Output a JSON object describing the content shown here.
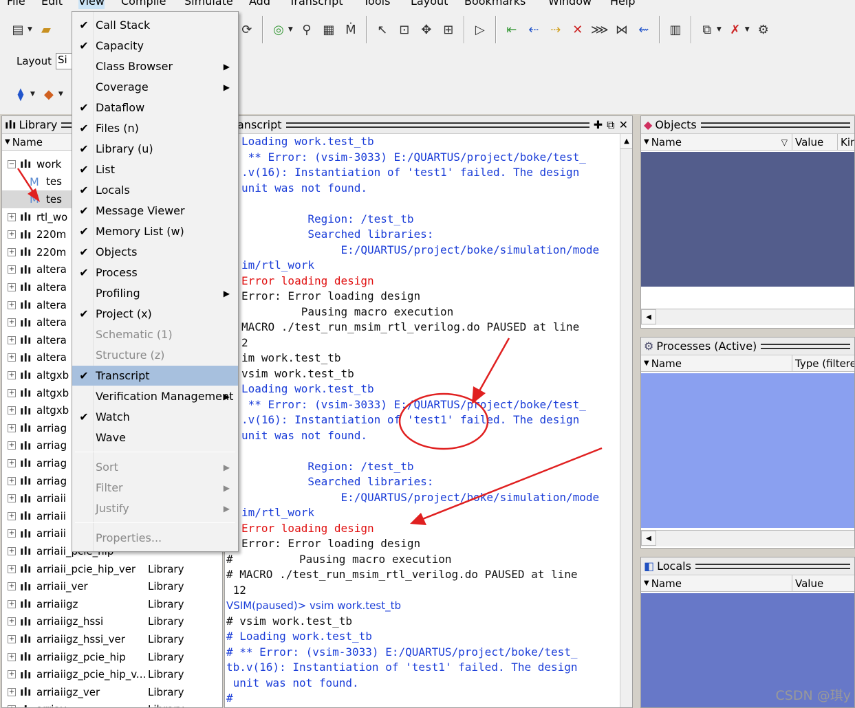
{
  "menubar": {
    "items": [
      "File",
      "Edit",
      "View",
      "Compile",
      "Simulate",
      "Add",
      "Transcript",
      "Tools",
      "Layout",
      "Bookmarks",
      "Window",
      "Help"
    ]
  },
  "toolbar": {
    "layout_label": "Layout",
    "layout_value": "Si"
  },
  "library": {
    "title": "Library",
    "col_name": "Name",
    "work": "work",
    "work_child1": "tes",
    "work_child2": "tes",
    "rows_truncated": [
      "rtl_wo",
      "220m",
      "220m",
      "altera",
      "altera",
      "altera",
      "altera",
      "altera",
      "altera",
      "altgxb",
      "altgxb",
      "altgxb",
      "arriag",
      "arriag",
      "arriag",
      "arriag",
      "arriaii",
      "arriaii",
      "arriaii",
      "arriaii_pcie_hip"
    ],
    "rows_full": [
      {
        "name": "arriaii_pcie_hip_ver",
        "type": "Library"
      },
      {
        "name": "arriaii_ver",
        "type": "Library"
      },
      {
        "name": "arriaiigz",
        "type": "Library"
      },
      {
        "name": "arriaiigz_hssi",
        "type": "Library"
      },
      {
        "name": "arriaiigz_hssi_ver",
        "type": "Library"
      },
      {
        "name": "arriaiigz_pcie_hip",
        "type": "Library"
      },
      {
        "name": "arriaiigz_pcie_hip_v...",
        "type": "Library"
      },
      {
        "name": "arriaiigz_ver",
        "type": "Library"
      },
      {
        "name": "arriav",
        "type": "Library"
      }
    ],
    "partial_type": "Library"
  },
  "view_menu": {
    "items": [
      {
        "label": "Call Stack",
        "checked": true
      },
      {
        "label": "Capacity",
        "checked": true
      },
      {
        "label": "Class Browser",
        "checked": false,
        "submenu": true
      },
      {
        "label": "Coverage",
        "checked": false,
        "submenu": true
      },
      {
        "label": "Dataflow",
        "checked": true
      },
      {
        "label": "Files (n)",
        "checked": true
      },
      {
        "label": "Library (u)",
        "checked": true
      },
      {
        "label": "List",
        "checked": true
      },
      {
        "label": "Locals",
        "checked": true
      },
      {
        "label": "Message Viewer",
        "checked": true
      },
      {
        "label": "Memory List (w)",
        "checked": true
      },
      {
        "label": "Objects",
        "checked": true
      },
      {
        "label": "Process",
        "checked": true
      },
      {
        "label": "Profiling",
        "checked": false,
        "submenu": true
      },
      {
        "label": "Project (x)",
        "checked": true
      },
      {
        "label": "Schematic (1)",
        "checked": false,
        "disabled": true
      },
      {
        "label": "Structure (z)",
        "checked": false,
        "disabled": true
      },
      {
        "label": "Transcript",
        "checked": true,
        "active": true
      },
      {
        "label": "Verification Management",
        "checked": false,
        "submenu": true
      },
      {
        "label": "Watch",
        "checked": true
      },
      {
        "label": "Wave",
        "checked": false
      }
    ],
    "group2": [
      {
        "label": "Sort",
        "submenu": true,
        "disabled": true
      },
      {
        "label": "Filter",
        "submenu": true,
        "disabled": true
      },
      {
        "label": "Justify",
        "submenu": true,
        "disabled": true
      }
    ],
    "group3": [
      {
        "label": "Properties...",
        "disabled": true
      }
    ]
  },
  "transcript": {
    "title": "Transcript",
    "lines": [
      {
        "text": "Loading work.test_tb",
        "color": "blue"
      },
      {
        "text": " ** Error: (vsim-3033) E:/QUARTUS/project/boke/test_",
        "color": "blue"
      },
      {
        "text": ".v(16): Instantiation of 'test1' failed. The design",
        "color": "blue"
      },
      {
        "text": "unit was not found.",
        "color": "blue"
      },
      {
        "text": "",
        "color": "blue"
      },
      {
        "text": "          Region: /test_tb",
        "color": "blue"
      },
      {
        "text": "          Searched libraries:",
        "color": "blue"
      },
      {
        "text": "               E:/QUARTUS/project/boke/simulation/mode",
        "color": "blue"
      },
      {
        "text": "im/rtl_work",
        "color": "blue"
      },
      {
        "text": "Error loading design",
        "color": "red"
      },
      {
        "text": "Error: Error loading design",
        "color": "black"
      },
      {
        "text": "         Pausing macro execution",
        "color": "black"
      },
      {
        "text": "MACRO ./test_run_msim_rtl_verilog.do PAUSED at line",
        "color": "black"
      },
      {
        "text": "2",
        "color": "black"
      },
      {
        "text": "im work.test_tb",
        "color": "black"
      },
      {
        "text": "vsim work.test_tb",
        "color": "black"
      },
      {
        "text": "Loading work.test_tb",
        "color": "blue"
      },
      {
        "text": " ** Error: (vsim-3033) E:/QUARTUS/project/boke/test_",
        "color": "blue"
      },
      {
        "text": ".v(16): Instantiation of 'test1' failed. The design",
        "color": "blue"
      },
      {
        "text": "unit was not found.",
        "color": "blue"
      },
      {
        "text": "",
        "color": "blue"
      },
      {
        "text": "          Region: /test_tb",
        "color": "blue"
      },
      {
        "text": "          Searched libraries:",
        "color": "blue"
      },
      {
        "text": "               E:/QUARTUS/project/boke/simulation/mode",
        "color": "blue"
      },
      {
        "text": "im/rtl_work",
        "color": "blue"
      },
      {
        "text": "Error loading design",
        "color": "red"
      },
      {
        "text": "Error: Error loading design",
        "color": "black"
      }
    ],
    "full_lines": [
      {
        "text": "#          Pausing macro execution",
        "color": "black"
      },
      {
        "text": "# MACRO ./test_run_msim_rtl_verilog.do PAUSED at line",
        "color": "black"
      },
      {
        "text": " 12",
        "color": "black"
      },
      {
        "text": "VSIM(paused)> vsim work.test_tb",
        "color": "blue"
      },
      {
        "text": "# vsim work.test_tb",
        "color": "black"
      },
      {
        "text": "# Loading work.test_tb",
        "color": "blue"
      },
      {
        "text": "# ** Error: (vsim-3033) E:/QUARTUS/project/boke/test_",
        "color": "blue"
      },
      {
        "text": "tb.v(16): Instantiation of 'test1' failed. The design",
        "color": "blue"
      },
      {
        "text": " unit was not found.",
        "color": "blue"
      },
      {
        "text": "#",
        "color": "blue"
      }
    ]
  },
  "objects": {
    "title": "Objects",
    "col_name": "Name",
    "col_value": "Value",
    "col_kind": "Kin"
  },
  "processes": {
    "title": "Processes (Active)",
    "col_name": "Name",
    "col_type": "Type (filtere"
  },
  "locals": {
    "title": "Locals",
    "col_name": "Name",
    "col_value": "Value"
  },
  "watermark": "CSDN @琪y",
  "colors": {
    "objects_bg": "#535d8c",
    "processes_bg": "#8aa0f0",
    "locals_bg": "#6778c8",
    "annotation_red": "#e02020",
    "menu_highlight": "#a7c0de"
  }
}
